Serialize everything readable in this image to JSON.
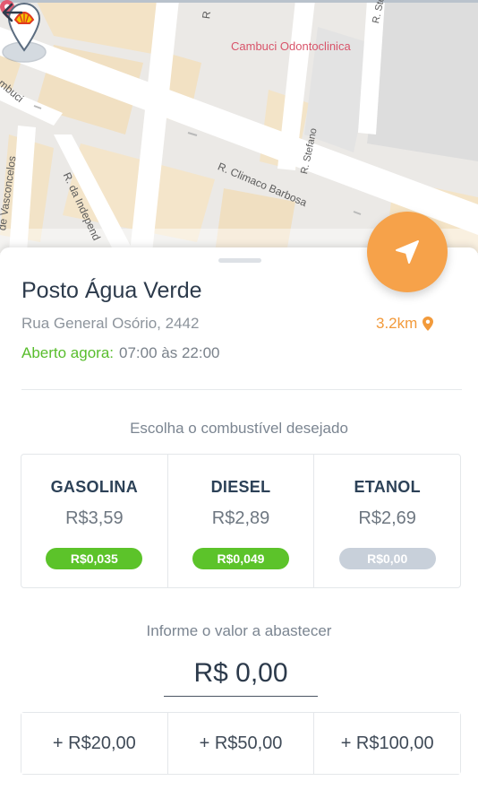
{
  "map": {
    "poi_label": "Cambuci Odontoclinica",
    "street_labels": {
      "climaco": "R. Climaco Barbosa",
      "independencia": "R. da Independ",
      "vasconcelos": "de Vasconcelos",
      "stefano": "R. Stefano",
      "stefano_top": "R. Stef",
      "top_r": "R",
      "cambuci": "mbuci"
    },
    "icons": {
      "back": "arrow-left-icon",
      "station": "shell-logo-pin",
      "poi": "location-pin-icon"
    }
  },
  "station": {
    "name": "Posto Água Verde",
    "address": "Rua General Osório, 2442",
    "distance": "3.2km",
    "open_label": "Aberto agora:",
    "hours": "07:00 às 22:00"
  },
  "fuel_section": {
    "title": "Escolha o combustível desejado",
    "fuels": [
      {
        "name": "GASOLINA",
        "price": "R$3,59",
        "badge": "R$0,035",
        "badge_color": "#5cc32a"
      },
      {
        "name": "DIESEL",
        "price": "R$2,89",
        "badge": "R$0,049",
        "badge_color": "#5cc32a"
      },
      {
        "name": "ETANOL",
        "price": "R$2,69",
        "badge": "R$0,00",
        "badge_color": "#c8d0da"
      }
    ]
  },
  "amount_section": {
    "title": "Informe o valor a abastecer",
    "value": "R$ 0,00",
    "quick_amounts": [
      "+ R$20,00",
      "+ R$50,00",
      "+ R$100,00"
    ]
  },
  "colors": {
    "accent": "#f6a24a",
    "open_green": "#58bd2c",
    "distance_orange": "#f29a3b",
    "poi_red": "#d8546a"
  }
}
